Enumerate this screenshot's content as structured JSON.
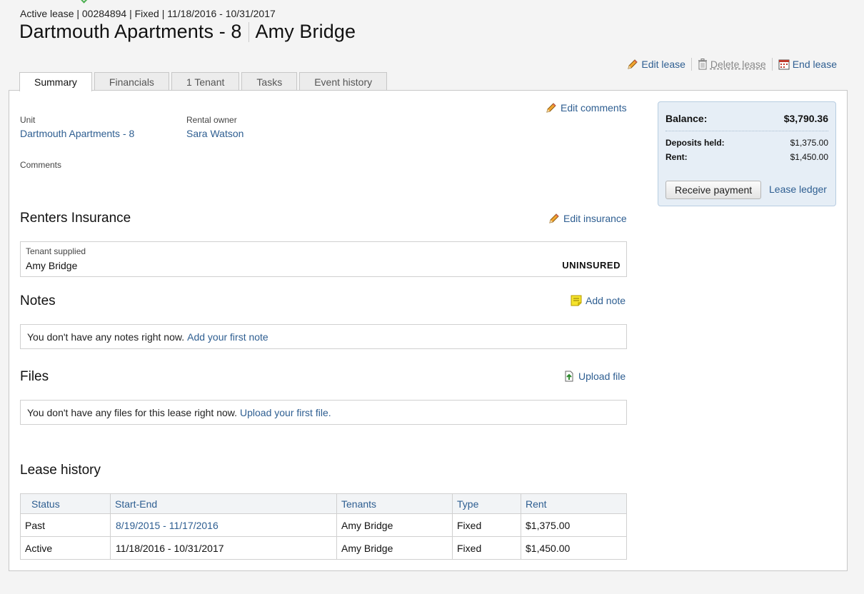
{
  "lease": {
    "meta": "Active lease | 00284894 | Fixed | 11/18/2016 - 10/31/2017",
    "unit_title": "Dartmouth Apartments - 8",
    "tenant_title": "Amy Bridge"
  },
  "actions": {
    "edit_lease": "Edit lease",
    "delete_lease": "Delete lease",
    "end_lease": "End lease"
  },
  "tabs": [
    {
      "label": "Summary",
      "active": true
    },
    {
      "label": "Financials"
    },
    {
      "label": "1 Tenant"
    },
    {
      "label": "Tasks"
    },
    {
      "label": "Event history"
    }
  ],
  "summary": {
    "edit_comments": "Edit comments",
    "unit_label": "Unit",
    "unit_value": "Dartmouth Apartments - 8",
    "owner_label": "Rental owner",
    "owner_value": "Sara Watson",
    "comments_label": "Comments"
  },
  "insurance": {
    "title": "Renters Insurance",
    "edit_label": "Edit insurance",
    "supplied_label": "Tenant supplied",
    "tenant": "Amy Bridge",
    "status": "UNINSURED"
  },
  "notes": {
    "title": "Notes",
    "add_label": "Add note",
    "empty_text": "You don't have any notes right now.",
    "empty_link": "Add your first note"
  },
  "files": {
    "title": "Files",
    "upload_label": "Upload file",
    "empty_text": "You don't have any files for this lease right now.",
    "empty_link": "Upload your first file."
  },
  "history": {
    "title": "Lease history",
    "columns": [
      "Status",
      "Start-End",
      "Tenants",
      "Type",
      "Rent"
    ],
    "rows": [
      {
        "status": "Past",
        "range": "8/19/2015 - 11/17/2016",
        "tenants": "Amy Bridge",
        "type": "Fixed",
        "rent": "$1,375.00"
      },
      {
        "status": "Active",
        "range": "11/18/2016 - 10/31/2017",
        "tenants": "Amy Bridge",
        "type": "Fixed",
        "rent": "$1,450.00"
      }
    ]
  },
  "balance": {
    "label": "Balance:",
    "value": "$3,790.36",
    "deposits_label": "Deposits held:",
    "deposits_value": "$1,375.00",
    "rent_label": "Rent:",
    "rent_value": "$1,450.00",
    "receive_payment": "Receive payment",
    "lease_ledger": "Lease ledger"
  },
  "colors": {
    "link": "#2e5e91",
    "balance_bg": "#e6eef6",
    "note_icon": "#f5e32b"
  }
}
